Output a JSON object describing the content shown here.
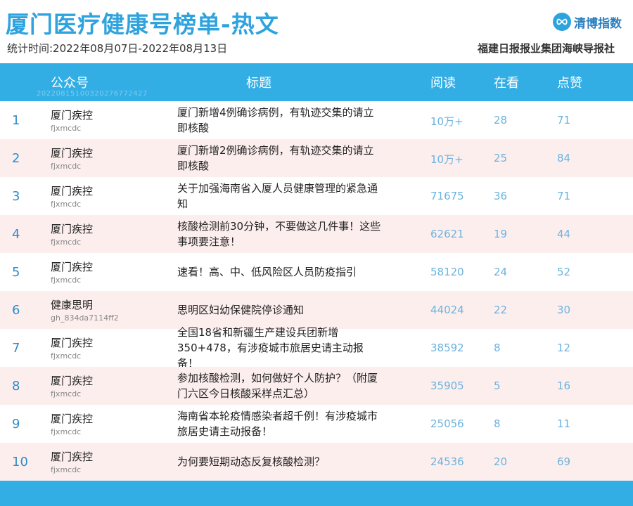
{
  "header": {
    "title": "厦门医疗健康号榜单-热文",
    "period": "统计时间:2022年08月07日-2022年08月13日",
    "logo_text": "清博指数",
    "publisher": "福建日报报业集团海峡导报社"
  },
  "table": {
    "headers": {
      "account": "公众号",
      "title": "标题",
      "read": "阅读",
      "watching": "在看",
      "likes": "点赞"
    },
    "header_code": "20220815100320276772427",
    "rows": [
      {
        "rank": "1",
        "account": "厦门疾控",
        "account_id": "fjxmcdc",
        "title": "厦门新增4例确诊病例，有轨迹交集的请立即核酸",
        "read": "10万+",
        "watching": "28",
        "likes": "71"
      },
      {
        "rank": "2",
        "account": "厦门疾控",
        "account_id": "fjxmcdc",
        "title": "厦门新增2例确诊病例，有轨迹交集的请立即核酸",
        "read": "10万+",
        "watching": "25",
        "likes": "84"
      },
      {
        "rank": "3",
        "account": "厦门疾控",
        "account_id": "fjxmcdc",
        "title": "关于加强海南省入厦人员健康管理的紧急通知",
        "read": "71675",
        "watching": "36",
        "likes": "71"
      },
      {
        "rank": "4",
        "account": "厦门疾控",
        "account_id": "fjxmcdc",
        "title": "核酸检测前30分钟，不要做这几件事！这些事项要注意！",
        "read": "62621",
        "watching": "19",
        "likes": "44"
      },
      {
        "rank": "5",
        "account": "厦门疾控",
        "account_id": "fjxmcdc",
        "title": "速看！高、中、低风险区人员防疫指引",
        "read": "58120",
        "watching": "24",
        "likes": "52"
      },
      {
        "rank": "6",
        "account": "健康思明",
        "account_id": "gh_834da7114ff2",
        "title": "思明区妇幼保健院停诊通知",
        "read": "44024",
        "watching": "22",
        "likes": "30"
      },
      {
        "rank": "7",
        "account": "厦门疾控",
        "account_id": "fjxmcdc",
        "title": "全国18省和新疆生产建设兵团新增350+478，有涉疫城市旅居史请主动报备！",
        "read": "38592",
        "watching": "8",
        "likes": "12"
      },
      {
        "rank": "8",
        "account": "厦门疾控",
        "account_id": "fjxmcdc",
        "title": "参加核酸检测，如何做好个人防护？（附厦门六区今日核酸采样点汇总）",
        "read": "35905",
        "watching": "5",
        "likes": "16"
      },
      {
        "rank": "9",
        "account": "厦门疾控",
        "account_id": "fjxmcdc",
        "title": "海南省本轮疫情感染者超千例！有涉疫城市旅居史请主动报备！",
        "read": "25056",
        "watching": "8",
        "likes": "11"
      },
      {
        "rank": "10",
        "account": "厦门疾控",
        "account_id": "fjxmcdc",
        "title": "为何要短期动态反复核酸检测？",
        "read": "24536",
        "watching": "20",
        "likes": "69"
      }
    ]
  },
  "colors": {
    "accent": "#33aee5",
    "title": "#2ea3de",
    "alt_row": "#fdeeee",
    "numbers": "#6cb3dd",
    "rank": "#2e8cc9"
  },
  "icons": {
    "logo": "infinity-logo-icon"
  }
}
